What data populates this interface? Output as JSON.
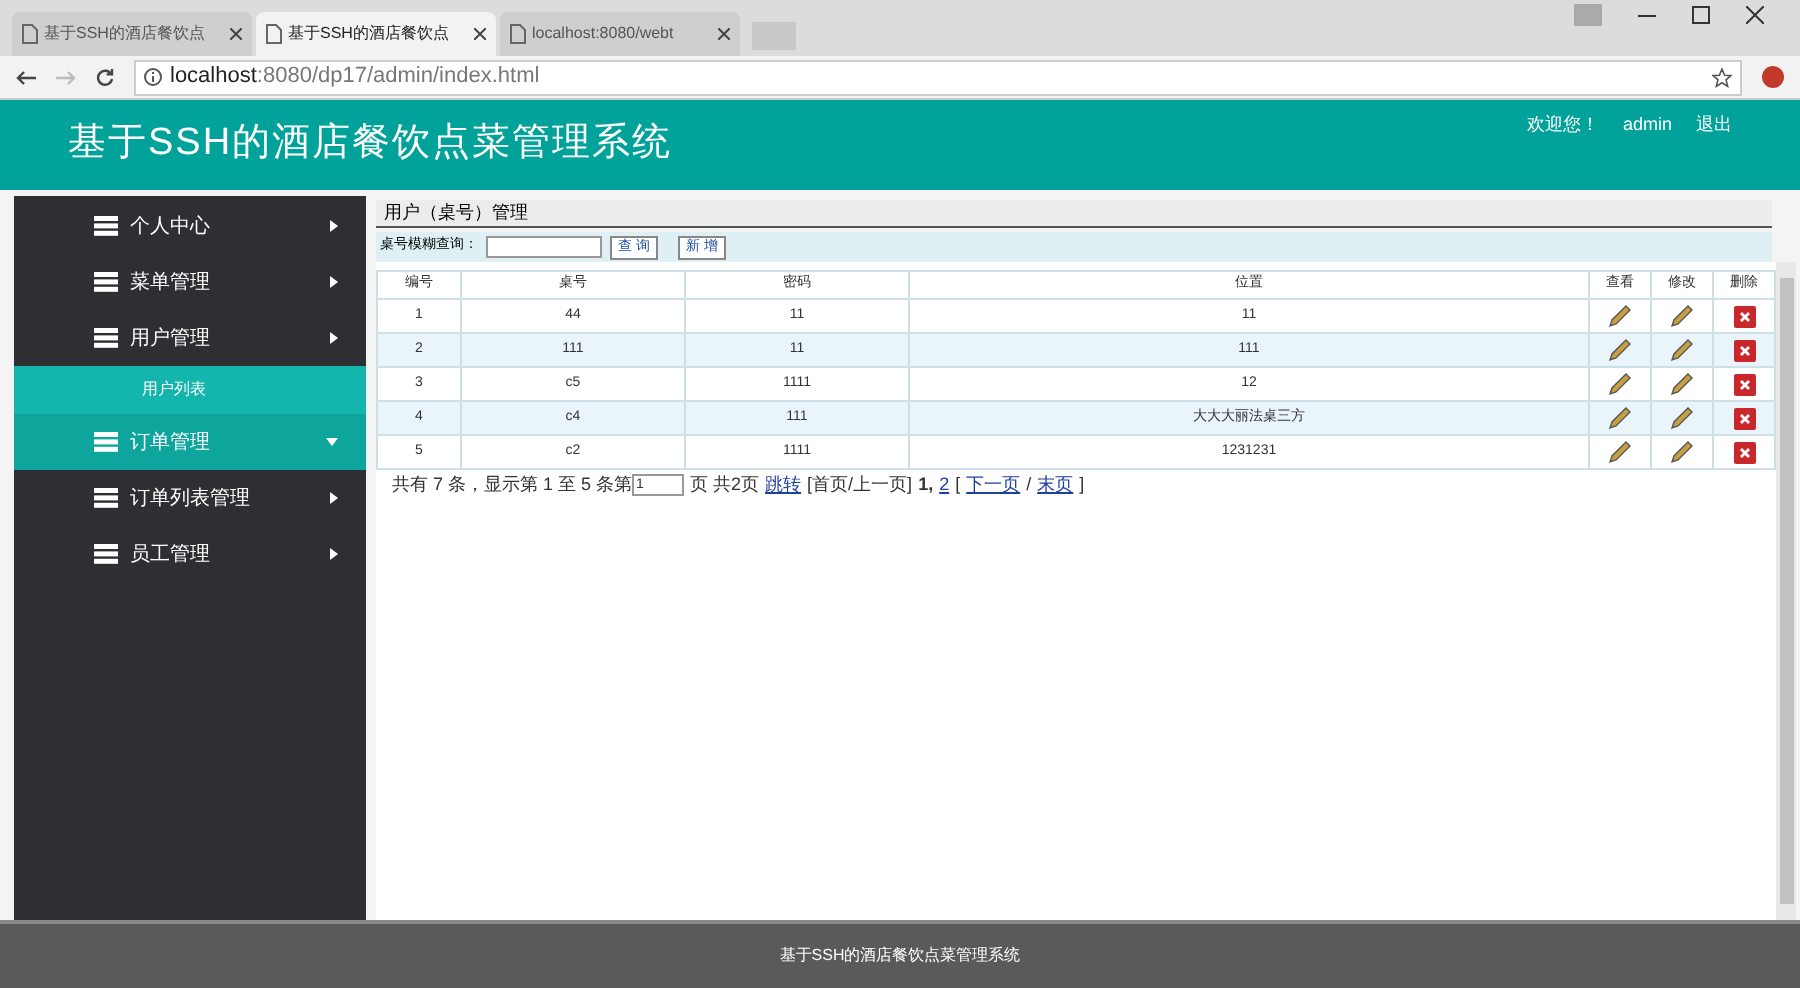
{
  "browser": {
    "tabs": [
      {
        "title": "基于SSH的酒店餐饮点",
        "selected": false
      },
      {
        "title": "基于SSH的酒店餐饮点",
        "selected": true
      },
      {
        "title": "localhost:8080/webt",
        "selected": false
      }
    ],
    "url_host": "localhost",
    "url_rest": ":8080/dp17/admin/index.html"
  },
  "header": {
    "title": "基于SSH的酒店餐饮点菜管理系统",
    "welcome": "欢迎您！",
    "user": "admin",
    "logout": "退出"
  },
  "sidebar": {
    "items": [
      {
        "label": "个人中心",
        "highlighted": false
      },
      {
        "label": "菜单管理",
        "highlighted": false
      },
      {
        "label": "用户管理",
        "highlighted": false,
        "children": [
          {
            "label": "用户列表",
            "selected": true
          }
        ]
      },
      {
        "label": "订单管理",
        "highlighted": true
      },
      {
        "label": "订单列表管理",
        "highlighted": false
      },
      {
        "label": "员工管理",
        "highlighted": false
      }
    ]
  },
  "panel": {
    "title": "用户（桌号）管理",
    "search_label": "桌号模糊查询：",
    "search_button": "查 询",
    "add_button": "新 增",
    "columns": [
      "编号",
      "桌号",
      "密码",
      "位置",
      "查看",
      "修改",
      "删除"
    ],
    "rows": [
      [
        "1",
        "44",
        "11",
        "11"
      ],
      [
        "2",
        "111",
        "11",
        "111"
      ],
      [
        "3",
        "c5",
        "1111",
        "12"
      ],
      [
        "4",
        "c4",
        "111",
        "大大大丽法桌三方"
      ],
      [
        "5",
        "c2",
        "1111",
        "1231231"
      ]
    ],
    "pager": [
      {
        "kind": "text",
        "text": "共有 7 条，显示第 1 至 5 条第"
      },
      {
        "kind": "input",
        "text": "1"
      },
      {
        "kind": "text",
        "text": "页 共2页"
      },
      {
        "kind": "link",
        "text": "跳转"
      },
      {
        "kind": "text",
        "text": "[首页/上一页]"
      },
      {
        "kind": "current",
        "text": "1,"
      },
      {
        "kind": "link",
        "text": "2"
      },
      {
        "kind": "text",
        "text": "["
      },
      {
        "kind": "link",
        "text": "下一页"
      },
      {
        "kind": "text",
        "text": "/"
      },
      {
        "kind": "link",
        "text": "末页"
      },
      {
        "kind": "text",
        "text": "]"
      }
    ]
  },
  "footer": {
    "text": "基于SSH的酒店餐饮点菜管理系统"
  }
}
